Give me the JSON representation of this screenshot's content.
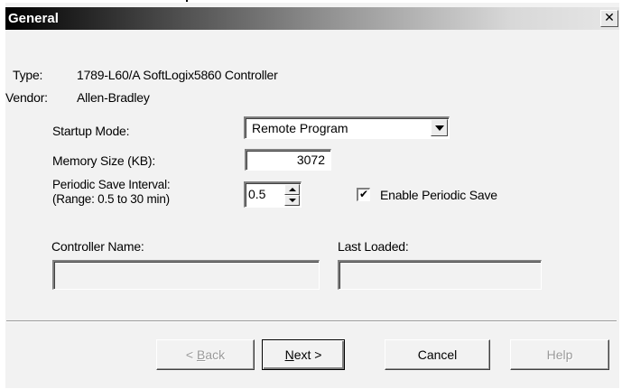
{
  "window": {
    "title": "General",
    "close_glyph": "✕"
  },
  "info": {
    "type_label": "Type:",
    "type_value": "1789-L60/A SoftLogix5860 Controller",
    "vendor_label": "Vendor:",
    "vendor_value": "Allen-Bradley"
  },
  "startup_mode": {
    "label": "Startup Mode:",
    "value": "Remote Program"
  },
  "memory_size": {
    "label": "Memory Size (KB):",
    "value": "3072"
  },
  "periodic_save": {
    "label_line1": "Periodic Save Interval:",
    "label_line2": "(Range: 0.5 to 30 min)",
    "value": "0.5"
  },
  "enable_periodic_save": {
    "label": "Enable Periodic Save",
    "checked": true,
    "check_glyph": "✔"
  },
  "controller_name": {
    "label": "Controller Name:",
    "value": ""
  },
  "last_loaded": {
    "label": "Last Loaded:",
    "value": ""
  },
  "buttons": {
    "back_prefix": "< ",
    "back_mnemonic": "B",
    "back_rest": "ack",
    "next_mnemonic": "N",
    "next_rest": "ext >",
    "cancel": "Cancel",
    "help": "Help"
  }
}
